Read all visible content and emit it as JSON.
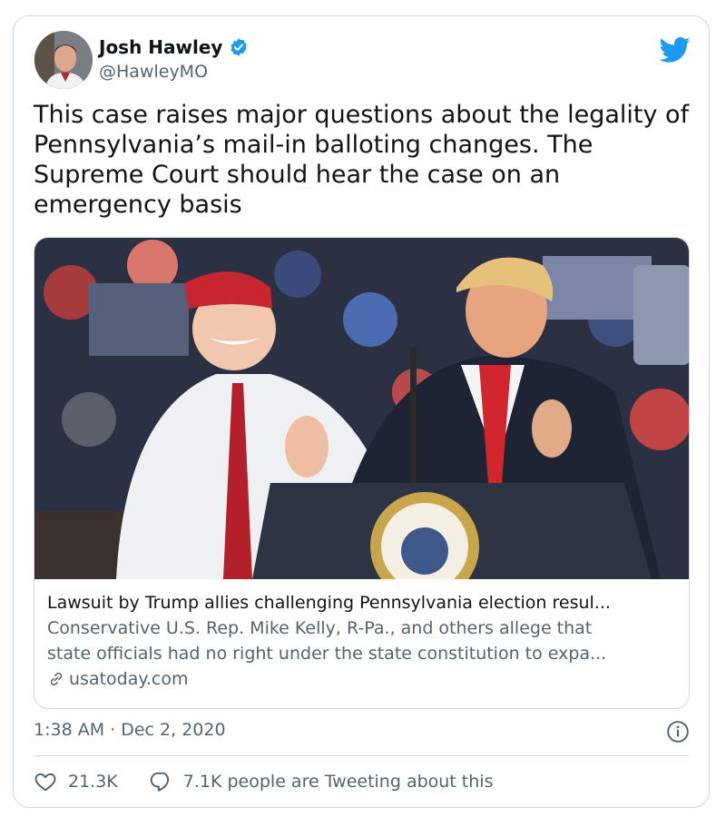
{
  "author": {
    "name": "Josh Hawley",
    "handle": "@HawleyMO",
    "verified": true,
    "avatar_icon": "user-photo"
  },
  "brand": {
    "icon": "twitter-bird-icon",
    "color": "#1d9bf0"
  },
  "tweet": {
    "text": "This case raises major questions about the legality of\nPennsylvania’s mail-in balloting changes. The\nSupreme Court should hear the case on an\nemergency basis"
  },
  "link_card": {
    "image_icon": "rally-photo",
    "title": "Lawsuit by Trump allies challenging Pennsylvania election resul...",
    "description_line1": "Conservative U.S. Rep. Mike Kelly, R-Pa., and others allege that",
    "description_line2": "state officials had no right under the state constitution to expa...",
    "domain": "usatoday.com",
    "domain_icon": "link-icon"
  },
  "meta": {
    "timestamp": "1:38 AM · Dec 2, 2020",
    "info_icon": "info-icon"
  },
  "actions": {
    "likes": "21.3K",
    "like_icon": "heart-icon",
    "reply_label": "7.1K people are Tweeting about this",
    "reply_icon": "speech-bubble-icon"
  },
  "colors": {
    "text": "#0f1419",
    "secondary": "#536471",
    "border": "#cfd9de",
    "verified": "#1d9bf0"
  }
}
